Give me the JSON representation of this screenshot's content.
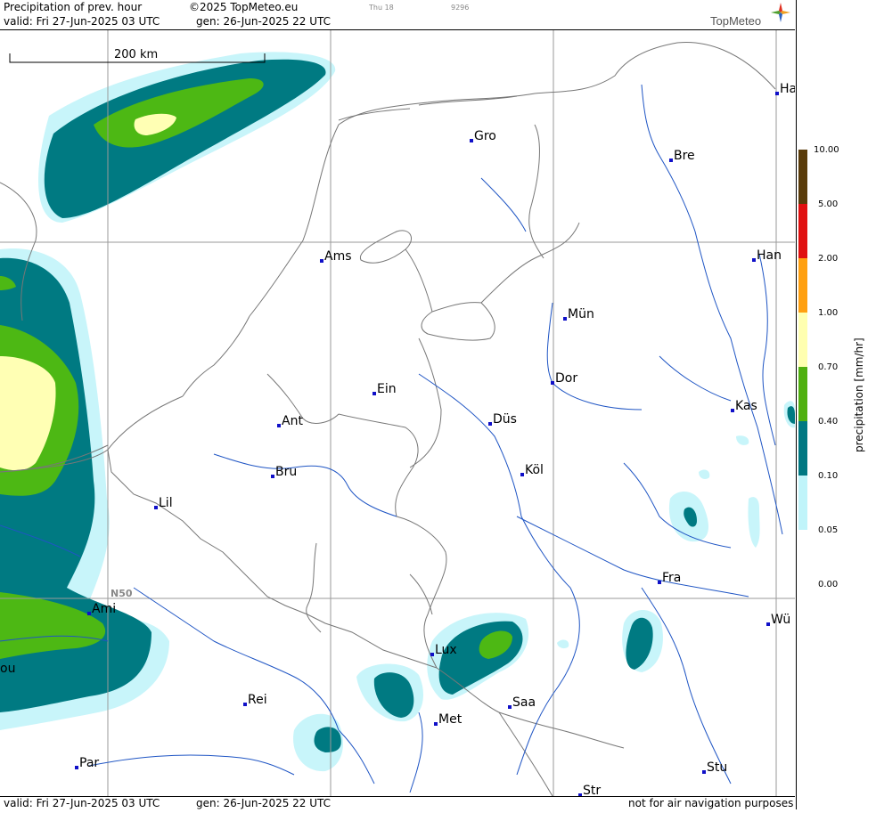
{
  "header": {
    "title": "Precipitation of prev. hour",
    "valid": "valid:  Fri   27-Jun-2025  03 UTC",
    "copyright": "©2025 TopMeteo.eu",
    "generated": "gen: 26-Jun-2025 22 UTC",
    "small_day": "Thu 18",
    "small_code": "9296",
    "brand": "TopMeteo"
  },
  "footer": {
    "valid": "valid:  Fri   27-Jun-2025  03 UTC",
    "generated": "gen: 26-Jun-2025 22 UTC",
    "disclaimer": "not for air navigation purposes"
  },
  "map": {
    "scale_label": "200 km",
    "grid_label": "N50",
    "cities": [
      {
        "name": "Gro"
      },
      {
        "name": "Bre"
      },
      {
        "name": "Ha"
      },
      {
        "name": "Ams"
      },
      {
        "name": "Han"
      },
      {
        "name": "Mün"
      },
      {
        "name": "Dor"
      },
      {
        "name": "Ein"
      },
      {
        "name": "Kas"
      },
      {
        "name": "Ant"
      },
      {
        "name": "Düs"
      },
      {
        "name": "Köl"
      },
      {
        "name": "Bru"
      },
      {
        "name": "Lil"
      },
      {
        "name": "Fra"
      },
      {
        "name": "Ami"
      },
      {
        "name": "Wü"
      },
      {
        "name": "Lux"
      },
      {
        "name": "Rei"
      },
      {
        "name": "Saa"
      },
      {
        "name": "Met"
      },
      {
        "name": "Par"
      },
      {
        "name": "Stu"
      },
      {
        "name": "Str"
      },
      {
        "name": "ou"
      }
    ]
  },
  "legend": {
    "title": "precipitation  [mm/hr]",
    "levels": [
      "10.00",
      "5.00",
      "2.00",
      "1.00",
      "0.70",
      "0.40",
      "0.10",
      "0.05",
      "0.00"
    ],
    "colors": [
      "#5a3c0a",
      "#e01010",
      "#ffa010",
      "#ffffb0",
      "#50b010",
      "#007882",
      "#c0f4fa",
      "#ffffff"
    ]
  },
  "colors": {
    "light": "#c8f5fa",
    "teal": "#007a82",
    "green": "#4db814",
    "yellow": "#ffffb4",
    "border": "#7a7a7a",
    "river": "#1a4fc0",
    "grid": "#999999",
    "city": "#1010c8"
  }
}
